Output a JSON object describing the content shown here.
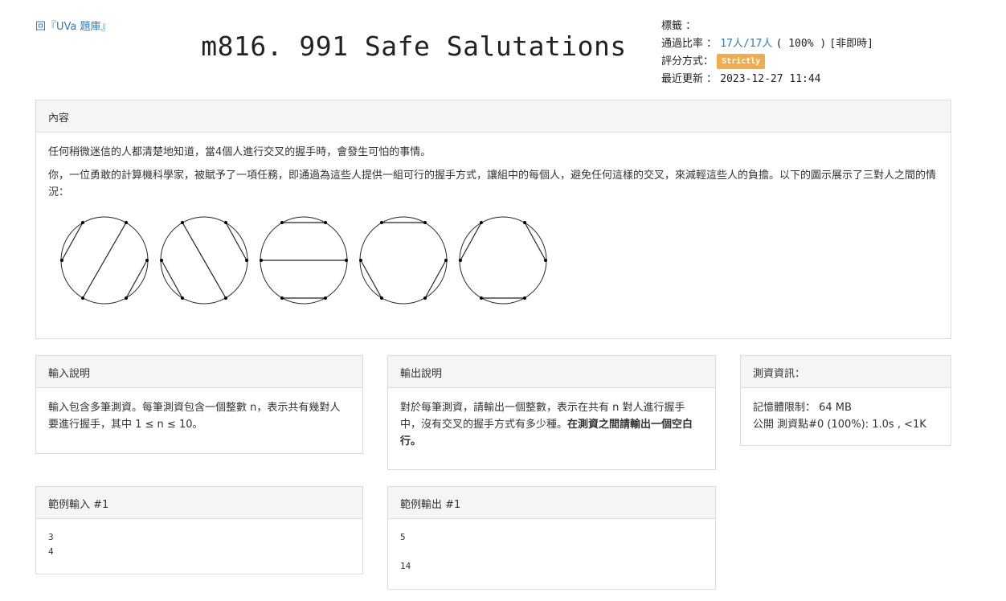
{
  "back_link": "回『UVa 題庫』",
  "title": "m816. 991 Safe Salutations",
  "meta": {
    "tags_label": "標籤 ：",
    "pass_rate_label": "通過比率 ：",
    "pass_people": "17人",
    "slash": "/",
    "total_people": "17人",
    "pass_percent": "( 100% )",
    "judge_mode": "[非即時]",
    "scoring_label": "評分方式：",
    "scoring_badge": "Strictly",
    "updated_label": "最近更新 ：",
    "updated_value": "2023-12-27 11:44"
  },
  "content": {
    "heading": "內容",
    "para1": "任何稍微迷信的人都清楚地知道，當4個人進行交叉的握手時，會發生可怕的事情。",
    "para2": "你，一位勇敢的計算機科學家，被賦予了一項任務，即通過為這些人提供一組可行的握手方式，讓組中的每個人，避免任何這樣的交叉，來減輕這些人的負擔。以下的圖示展示了三對人之間的情況："
  },
  "input_desc": {
    "heading": "輸入說明",
    "text": "輸入包含多筆測資。每筆測資包含一個整數 n，表示共有幾對人要進行握手，其中 1 ≤ n ≤ 10。"
  },
  "output_desc": {
    "heading": "輸出說明",
    "text_plain": "對於每筆測資，請輸出一個整數，表示在共有 n 對人進行握手中，沒有交叉的握手方式有多少種。",
    "text_bold": "在測資之間請輸出一個空白行。"
  },
  "test_info": {
    "heading": "測資資訊：",
    "memory": "記憶體限制： 64 MB",
    "case0": "公開 測資點#0 (100%): 1.0s , <1K"
  },
  "sample_input": {
    "heading": "範例輸入 #1",
    "text": "3\n4"
  },
  "sample_output": {
    "heading": "範例輸出 #1",
    "text": "5\n\n14"
  }
}
